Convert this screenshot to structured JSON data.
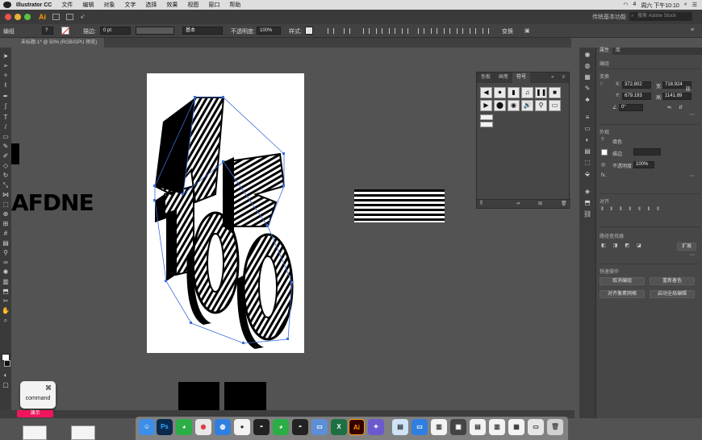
{
  "menubar": {
    "app_name": "Illustrator CC",
    "items": [
      "文件",
      "编辑",
      "对象",
      "文字",
      "选择",
      "效果",
      "视图",
      "窗口",
      "帮助"
    ],
    "clock": "周六 下午10:10",
    "battery": "4"
  },
  "appbar": {
    "logo": "Ai",
    "workspace": "传统基本功能",
    "search_placeholder": "搜索 Adobe Stock"
  },
  "controlbar": {
    "selection_label": "编组",
    "stroke_label": "描边:",
    "stroke_value": "0 pt",
    "brush_label": "基本",
    "opacity_label": "不透明度:",
    "opacity_value": "100%",
    "style_label": "样式:",
    "transform_label": "变换"
  },
  "document": {
    "tab_title": "未标题-1* @ 50% (RGB/GPU 预览)"
  },
  "canvas": {
    "pasteboard_text": "AFDNE",
    "artwork_text": "AE 100"
  },
  "float_panel": {
    "tabs": [
      "色板",
      "画笔",
      "符号"
    ],
    "active_tab": "符号",
    "symbols": [
      "◀",
      "⏺",
      "▮",
      "♫",
      "❚❚",
      "■",
      "▶",
      "⬤",
      "◉",
      "🔊",
      "⚲",
      "▭"
    ]
  },
  "properties": {
    "tabs": [
      "属性",
      "库"
    ],
    "section_selection": "编组",
    "section_transform": "变换",
    "x_label": "X:",
    "x_value": "372.802",
    "y_label": "Y:",
    "y_value": "679.193",
    "w_label": "宽:",
    "w_value": "718.924",
    "h_label": "高:",
    "h_value": "1141.89",
    "angle_value": "0°",
    "section_appearance": "外观",
    "fill_label": "填色",
    "stroke_label": "描边",
    "opacity_label": "不透明度",
    "opacity_value": "100%",
    "section_align": "对齐",
    "section_pathfinder": "路径查找器",
    "expand_label": "扩展",
    "section_quick_actions": "快速操作",
    "btn_ungroup": "取消编组",
    "btn_recolor": "重新着色",
    "btn_align_pixel": "对齐像素网格",
    "btn_global_edit": "启动全局编辑"
  },
  "overlay": {
    "key_symbol": "⌘",
    "key_label": "command",
    "badge": "演示"
  },
  "colors": {
    "accent": "#ff9a00",
    "panel_bg": "#474747",
    "canvas_bg": "#535353",
    "badge": "#f0155c"
  }
}
